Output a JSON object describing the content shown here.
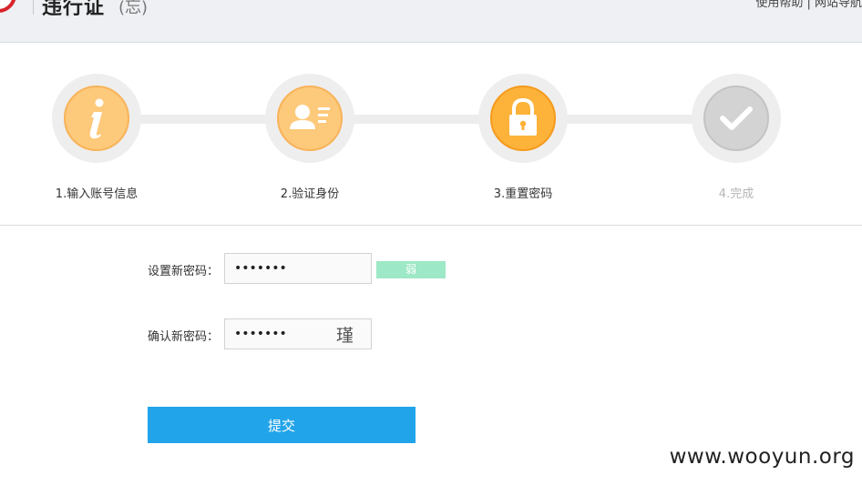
{
  "header": {
    "site_title": "违行证",
    "site_subtitle": "(忘)",
    "top_right": "使用帮助 | 网站导航"
  },
  "steps": [
    {
      "label": "1.输入账号信息",
      "state": "done",
      "icon": "info-icon"
    },
    {
      "label": "2.验证身份",
      "state": "done",
      "icon": "id-card-icon"
    },
    {
      "label": "3.重置密码",
      "state": "active",
      "icon": "lock-icon"
    },
    {
      "label": "4.完成",
      "state": "todo",
      "icon": "checkmark-icon"
    }
  ],
  "form": {
    "new_password_label": "设置新密码：",
    "new_password_value": "•••••••",
    "strength_label": "弱",
    "confirm_password_label": "确认新密码：",
    "confirm_password_value": "•••••••",
    "ime_candidate": "瑾",
    "submit_label": "提交"
  },
  "watermark": "www.wooyun.org",
  "colors": {
    "step_done": "#fdc97a",
    "step_active": "#fdb23a",
    "step_todo": "#d3d3d3",
    "strength_weak": "#9de8c6",
    "submit": "#22a4ea"
  }
}
